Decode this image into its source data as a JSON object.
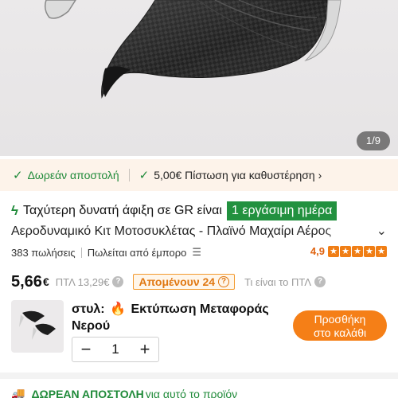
{
  "gallery": {
    "counter": "1/9",
    "image_alt": "carbon-fiber motorcycle side winglets"
  },
  "perks": {
    "free_shipping": "Δωρεάν αποστολή",
    "credit": "5,00€ Πίστωση για καθυστέρηση",
    "credit_chevron": "›"
  },
  "fast_arrival": {
    "text": "Ταχύτερη δυνατή άφιξη σε GR είναι",
    "badge": "1 εργάσιμη ημέρα"
  },
  "product": {
    "title": "Αεροδυναμικό Κιτ Μοτοσυκλέτας - Πλαϊνό Μαχαίρι Αέρος",
    "sales": "383 πωλήσεις",
    "seller": "Πωλείται από έμπορο",
    "rating": "4,9",
    "stars": 5
  },
  "price": {
    "main": "5,66",
    "currency": "€",
    "old": "ΠΤΛ 13,29€",
    "remaining": "Απομένουν 24",
    "what_is": "Τι είναι το ΠΤΛ"
  },
  "option": {
    "style_key": "στυλ:",
    "style_value": "Εκτύπωση Μεταφοράς Νερού",
    "quantity": "1",
    "minus": "−",
    "plus": "+"
  },
  "cart": {
    "label_line1": "Προσθήκη",
    "label_line2": "στο καλάθι"
  },
  "bottom": {
    "free_label": "ΔΩΡΕΑΝ ΑΠΟΣΤΟΛΗ",
    "free_rest": "για αυτό το προϊόν"
  },
  "colors": {
    "accent_orange": "#f57f17",
    "green": "#1f8a39",
    "badge_green": "#22913f"
  }
}
